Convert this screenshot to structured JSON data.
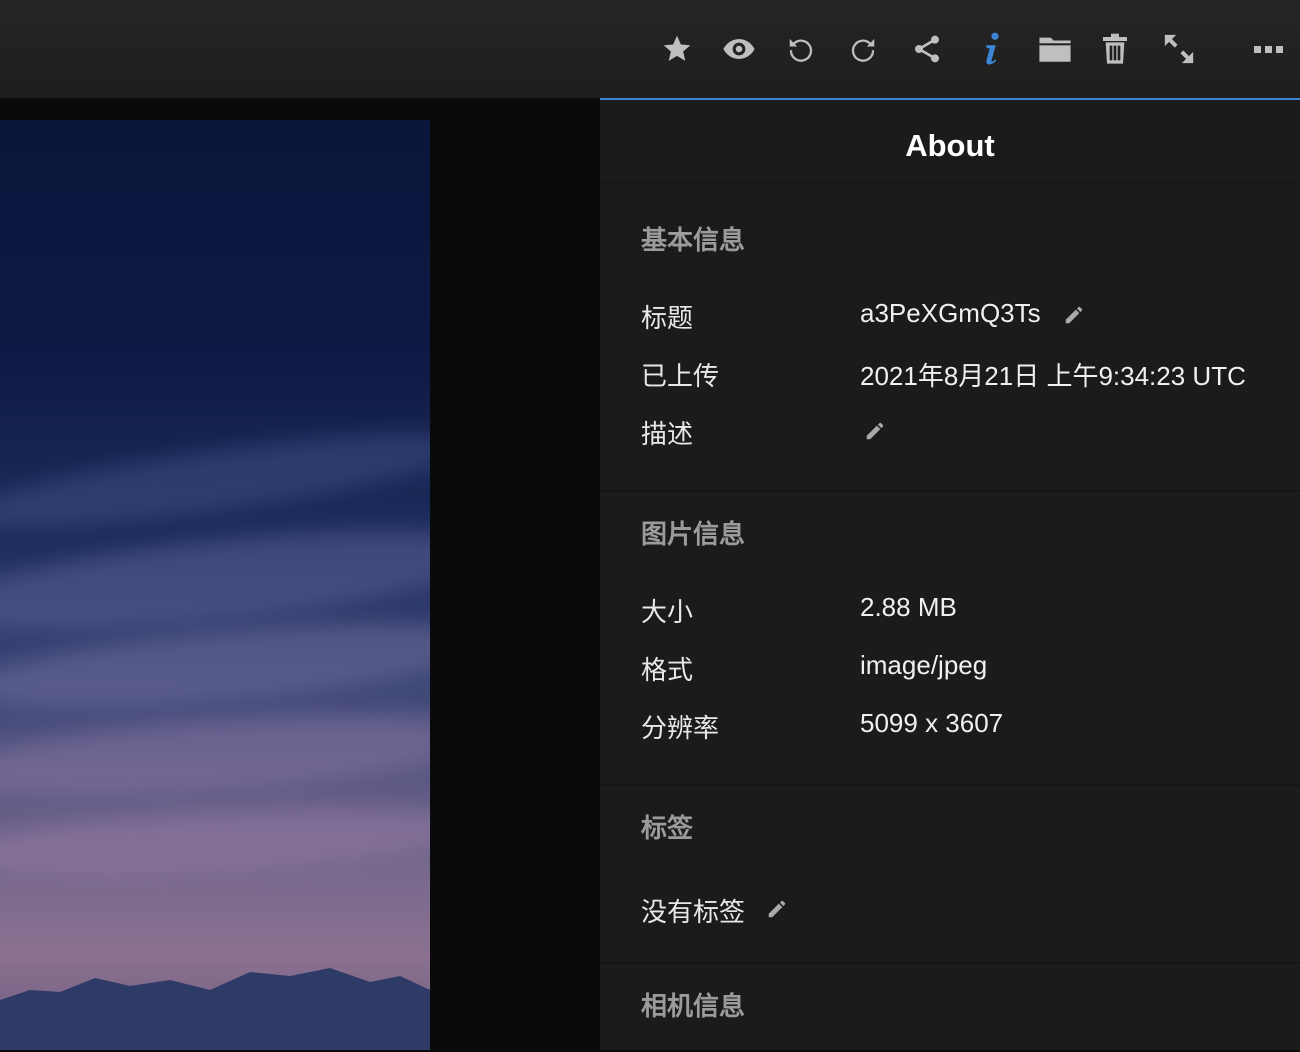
{
  "colors": {
    "accent": "#3d86d6",
    "icon": "#bfbfbf"
  },
  "toolbar": {
    "icons": [
      "star-icon",
      "eye-icon",
      "rotate-left-icon",
      "rotate-right-icon",
      "share-icon",
      "info-icon",
      "folder-icon",
      "trash-icon",
      "fullscreen-icon",
      "more-icon"
    ]
  },
  "info": {
    "title": "About",
    "basic": {
      "heading": "基本信息",
      "title_label": "标题",
      "title_value": "a3PeXGmQ3Ts",
      "uploaded_label": "已上传",
      "uploaded_value": "2021年8月21日 上午9:34:23 UTC",
      "description_label": "描述"
    },
    "image": {
      "heading": "图片信息",
      "size_label": "大小",
      "size_value": "2.88 MB",
      "format_label": "格式",
      "format_value": "image/jpeg",
      "resolution_label": "分辨率",
      "resolution_value": "5099 x 3607"
    },
    "tags": {
      "heading": "标签",
      "empty_text": "没有标签"
    },
    "camera": {
      "heading": "相机信息"
    }
  }
}
